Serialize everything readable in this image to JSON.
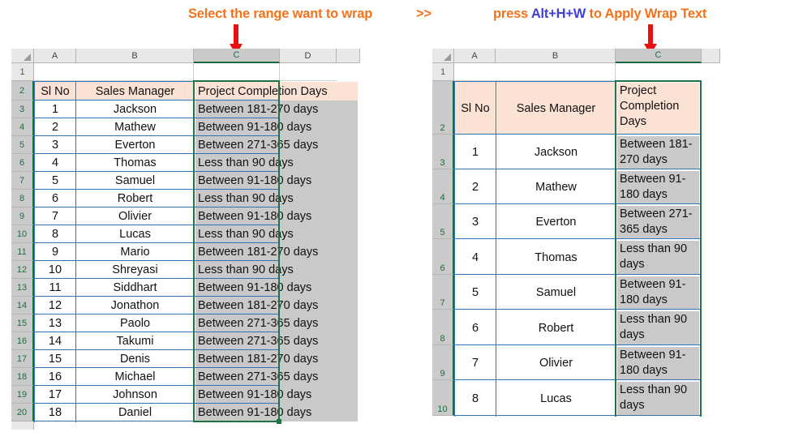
{
  "caption": {
    "left": "Select the range want to wrap",
    "arrows": ">>",
    "right_pre": "press ",
    "right_kbd": "Alt+H+W",
    "right_post": " to Apply Wrap Text",
    "accent_orange": "#F4721B",
    "accent_blue": "#4040D8",
    "arrow_color": "#E81010"
  },
  "left_sheet": {
    "column_headers": [
      "A",
      "B",
      "C",
      "D"
    ],
    "selected_column": "C",
    "row_headers": [
      "1",
      "2",
      "3",
      "4",
      "5",
      "6",
      "7",
      "8",
      "9",
      "10",
      "11",
      "12",
      "13",
      "14",
      "15",
      "16",
      "17",
      "18",
      "19",
      "20"
    ],
    "header_row": {
      "a": "Sl No",
      "b": "Sales Manager",
      "c": "Project Completion Days"
    },
    "rows": [
      {
        "sl": "1",
        "name": "Jackson",
        "days": "Between 181-270 days"
      },
      {
        "sl": "2",
        "name": "Mathew",
        "days": "Between 91-180 days"
      },
      {
        "sl": "3",
        "name": "Everton",
        "days": "Between 271-365 days"
      },
      {
        "sl": "4",
        "name": "Thomas",
        "days": "Less than 90 days"
      },
      {
        "sl": "5",
        "name": "Samuel",
        "days": "Between 91-180 days"
      },
      {
        "sl": "6",
        "name": "Robert",
        "days": "Less than 90 days"
      },
      {
        "sl": "7",
        "name": "Olivier",
        "days": "Between 91-180 days"
      },
      {
        "sl": "8",
        "name": "Lucas",
        "days": "Less than 90 days"
      },
      {
        "sl": "9",
        "name": "Mario",
        "days": "Between 181-270 days"
      },
      {
        "sl": "10",
        "name": "Shreyasi",
        "days": "Less than 90 days"
      },
      {
        "sl": "11",
        "name": "Siddhart",
        "days": "Between 91-180 days"
      },
      {
        "sl": "12",
        "name": "Jonathon",
        "days": "Between 181-270 days"
      },
      {
        "sl": "13",
        "name": "Paolo",
        "days": "Between 271-365 days"
      },
      {
        "sl": "14",
        "name": "Takumi",
        "days": "Between 271-365 days"
      },
      {
        "sl": "15",
        "name": "Denis",
        "days": "Between 181-270 days"
      },
      {
        "sl": "16",
        "name": "Michael",
        "days": "Between 271-365 days"
      },
      {
        "sl": "17",
        "name": "Johnson",
        "days": "Between 91-180 days"
      },
      {
        "sl": "18",
        "name": "Daniel",
        "days": "Between 91-180 days"
      }
    ]
  },
  "right_sheet": {
    "column_headers": [
      "A",
      "B",
      "C"
    ],
    "selected_column": "C",
    "row_headers": [
      "1",
      "2",
      "3",
      "4",
      "5",
      "6",
      "7",
      "8",
      "9",
      "10"
    ],
    "header_row": {
      "a": "Sl No",
      "b": "Sales Manager",
      "c": "Project Completion Days"
    },
    "rows": [
      {
        "sl": "1",
        "name": "Jackson",
        "days": "Between 181-270 days"
      },
      {
        "sl": "2",
        "name": "Mathew",
        "days": "Between 91-180 days"
      },
      {
        "sl": "3",
        "name": "Everton",
        "days": "Between 271-365 days"
      },
      {
        "sl": "4",
        "name": "Thomas",
        "days": "Less than 90 days"
      },
      {
        "sl": "5",
        "name": "Samuel",
        "days": "Between 91-180 days"
      },
      {
        "sl": "6",
        "name": "Robert",
        "days": "Less than 90 days"
      },
      {
        "sl": "7",
        "name": "Olivier",
        "days": "Between 91-180 days"
      },
      {
        "sl": "8",
        "name": "Lucas",
        "days": "Less than 90 days"
      }
    ]
  },
  "colors": {
    "header_fill": "#FBE2D5",
    "selection_fill": "#C9C9C9",
    "selection_border": "#217346",
    "gridline_blue": "#2E75B6",
    "col_header_bg": "#E8E8E8"
  }
}
